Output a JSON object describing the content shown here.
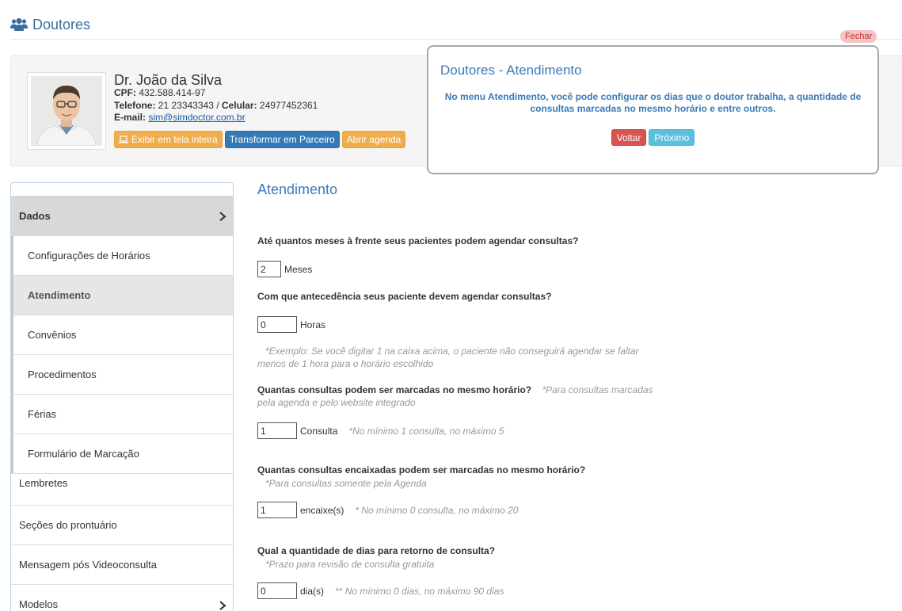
{
  "page": {
    "title": "Doutores",
    "icon": "users-icon"
  },
  "doctor": {
    "name": "Dr. João da Silva",
    "cpf_label": "CPF:",
    "cpf": "432.588.414-97",
    "phone_label": "Telefone:",
    "phone": "21 23343343",
    "cell_label": "Celular:",
    "cell": "24977452361",
    "email_label": "E-mail:",
    "email": "sim@simdoctor.com.br"
  },
  "actions": {
    "fullscreen": "Exibir em tela inteira",
    "partner": "Transformar em Parceiro",
    "agenda": "Abrir agenda"
  },
  "tour": {
    "close": "Fechar",
    "title": "Doutores - Atendimento",
    "text": "No menu Atendimento, você pode configurar os dias que o doutor trabalha, a quantidade de consultas marcadas no mesmo horário e entre outros.",
    "back": "Voltar",
    "next": "Próximo"
  },
  "sidebar": {
    "header": "Dados",
    "items": [
      "Configurações de Horários",
      "Atendimento",
      "Convênios",
      "Procedimentos",
      "Férias",
      "Formulário de Marcação"
    ],
    "extra": [
      "Lembretes",
      "Seções do prontuário",
      "Mensagem pós Videoconsulta",
      "Modelos"
    ]
  },
  "main": {
    "title": "Atendimento",
    "q1": "Até quantos meses à frente seus pacientes podem agendar consultas?",
    "q1_value": "2",
    "q1_unit": "Meses",
    "q2": "Com que antecedência seus paciente devem agendar consultas?",
    "q2_value": "0",
    "q2_unit": "Horas",
    "q2_note": "*Exemplo: Se você digitar 1 na caixa acima, o paciente não conseguirá agendar se faltar menos de 1 hora para o horário escolhido",
    "q3": "Quantas consultas podem ser marcadas no mesmo horário?",
    "q3_hint": "*Para consultas marcadas pela agenda e pelo website integrado",
    "q3_value": "1",
    "q3_unit": "Consulta",
    "q3_range": "*No mínimo 1 consulta, no máximo 5",
    "q4": "Quantas consultas encaixadas podem ser marcadas no mesmo horário?",
    "q4_hint": "*Para consultas somente pela Agenda",
    "q4_value": "1",
    "q4_unit": "encaixe(s)",
    "q4_range": "* No mínimo 0 consulta, no máximo 20",
    "q5": "Qual a quantidade de dias para retorno de consulta?",
    "q5_hint": "*Prazo para revisão de consulta gratuita",
    "q5_value": "0",
    "q5_unit": "dia(s)",
    "q5_range": "** No mínimo 0 dias, no máximo 90 dias"
  }
}
